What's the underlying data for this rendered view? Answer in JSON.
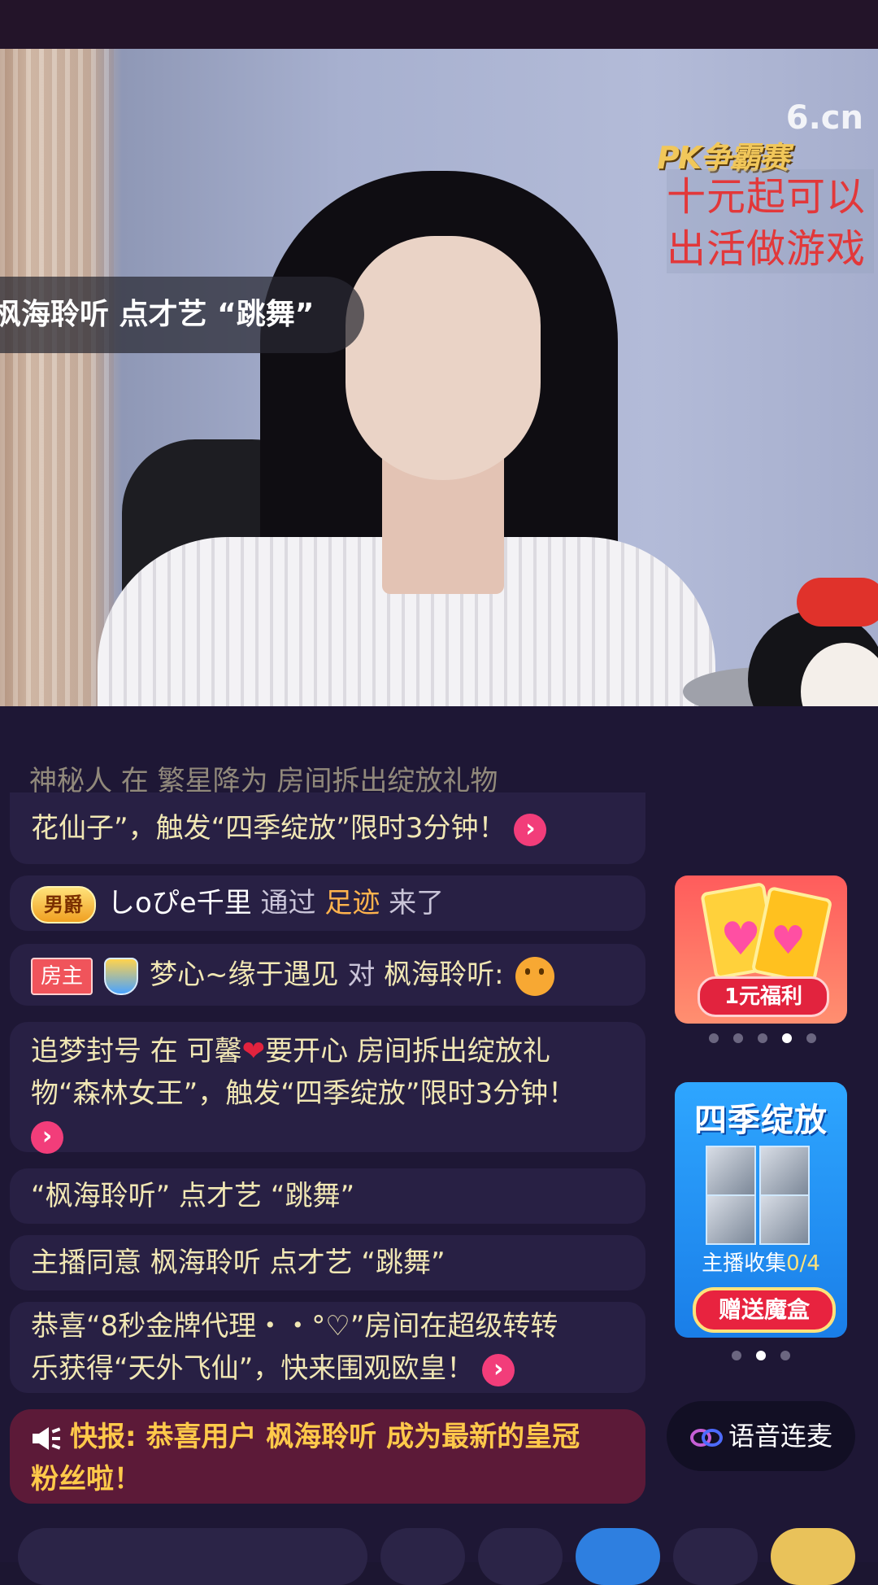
{
  "video": {
    "watermark": "6.cn",
    "pk_title": "PK争霸赛",
    "pk_lines": [
      "十元起可以",
      "出活做游戏"
    ],
    "floating_notice": "枫海聆听 点才艺 “跳舞”"
  },
  "chat": {
    "messages": [
      {
        "id": "m0",
        "partial_top": "神秘人 在 繁星降为 房间拆出绽放礼物",
        "text": "花仙子”，触发“四季绽放”限时3分钟！"
      },
      {
        "id": "m1",
        "badge": "男爵",
        "user": "しoぴe千里",
        "middle": "通过",
        "source": "足迹",
        "suffix": "来了"
      },
      {
        "id": "m2",
        "badge": "房主",
        "user": "梦心~缘于遇见",
        "middle": "对",
        "target": "枫海聆听:"
      },
      {
        "id": "m3",
        "line1": "追梦封号 在 可馨",
        "line1b": "要开心 房间拆出绽放礼",
        "line2": "物“森林女王”，触发“四季绽放”限时3分钟！"
      },
      {
        "id": "m4",
        "text": "“枫海聆听” 点才艺 “跳舞”"
      },
      {
        "id": "m5",
        "text": "主播同意 枫海聆听 点才艺 “跳舞”"
      },
      {
        "id": "m6",
        "line1": "恭喜“8秒金牌代理・・°♡”房间在超级转转",
        "line2": "乐获得“天外飞仙”，快来围观欧皇！"
      }
    ],
    "flash": {
      "prefix": "快报:",
      "line1": " 恭喜用户 枫海聆听 成为最新的皇冠",
      "line2": "粉丝啦！"
    }
  },
  "promo": {
    "welfare_label": "1元福利",
    "season_title": "四季绽放",
    "collect_label": "主播收集",
    "collect_count": "0/4",
    "send_button": "赠送魔盒"
  },
  "voice_link_label": "语音连麦",
  "colors": {
    "accent_pink": "#f23d7a",
    "chat_text": "#f1e7b4",
    "flash_text": "#ffc94a"
  }
}
